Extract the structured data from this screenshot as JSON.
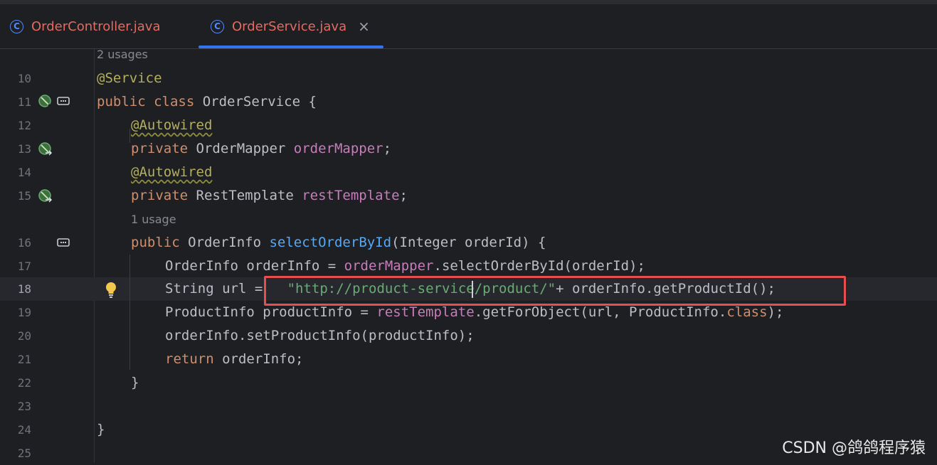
{
  "tabs": [
    {
      "label": "OrderController.java",
      "icon": "class-icon",
      "active": false
    },
    {
      "label": "OrderService.java",
      "icon": "class-icon",
      "active": true,
      "close_icon": "close-icon"
    }
  ],
  "hints": {
    "class_usages": "2 usages",
    "method_usages": "1 usage"
  },
  "lines": {
    "10": {
      "num": "10",
      "t1": "@Service"
    },
    "11": {
      "num": "11",
      "t1": "public",
      "t2": " ",
      "t3": "class",
      "t4": " OrderService {"
    },
    "12": {
      "num": "12",
      "t1": "@Autowired"
    },
    "13": {
      "num": "13",
      "t1": "private",
      "t2": " OrderMapper ",
      "t3": "orderMapper",
      "t4": ";"
    },
    "14": {
      "num": "14",
      "t1": "@Autowired"
    },
    "15": {
      "num": "15",
      "t1": "private",
      "t2": " RestTemplate ",
      "t3": "restTemplate",
      "t4": ";"
    },
    "16": {
      "num": "16",
      "t1": "public",
      "t2": " OrderInfo ",
      "t3": "selectOrderById",
      "t4": "(Integer orderId) {"
    },
    "17": {
      "num": "17",
      "t1": "OrderInfo orderInfo = ",
      "t2": "orderMapper",
      "t3": ".selectOrderById(orderId);"
    },
    "18": {
      "num": "18",
      "t1": "String url = ",
      "t2": "\"http://product-service/product/\"",
      "t3": "+ orderInfo.getProductId();"
    },
    "19": {
      "num": "19",
      "t1": "ProductInfo productInfo = ",
      "t2": "restTemplate",
      "t3": ".getForObject(url, ProductInfo.",
      "t4": "class",
      "t5": ");"
    },
    "20": {
      "num": "20",
      "t1": "orderInfo.setProductInfo(productInfo);"
    },
    "21": {
      "num": "21",
      "t1": "return",
      "t2": " orderInfo;"
    },
    "22": {
      "num": "22",
      "t1": "}"
    },
    "23": {
      "num": "23"
    },
    "24": {
      "num": "24",
      "t1": "}"
    },
    "25": {
      "num": "25"
    }
  },
  "gutter_icons": [
    "spring-bean-icon",
    "spring-inject-icon",
    "spring-inject-icon",
    "implement-icon",
    "implement-icon",
    "lightbulb-icon"
  ],
  "colors": {
    "background": "#1e1f22",
    "keyword": "#cf8e6d",
    "annotation": "#b3ae60",
    "field": "#c77dbb",
    "method": "#56a8f5",
    "string": "#6aab73",
    "highlight_box": "#e84e4f",
    "tab_accent": "#3574f0"
  },
  "watermark": "CSDN @鸽鸽程序猿"
}
